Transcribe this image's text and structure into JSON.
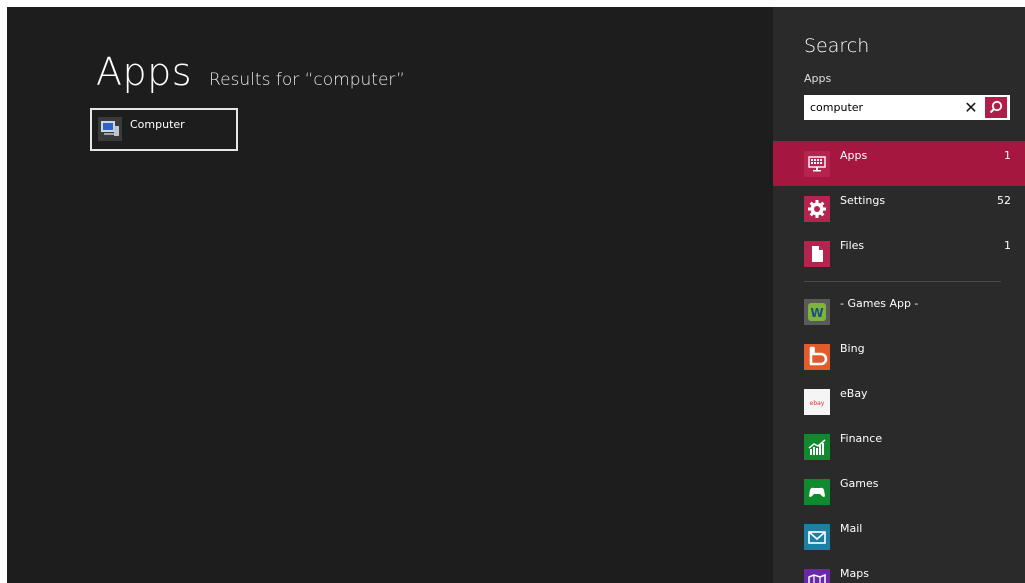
{
  "results": {
    "title": "Apps",
    "subtitle": "Results for “computer”",
    "items": [
      {
        "label": "Computer",
        "icon": "computer-icon"
      }
    ]
  },
  "charm": {
    "title": "Search",
    "scope": "Apps",
    "query": "computer",
    "scopes": [
      {
        "label": "Apps",
        "count": "1",
        "icon": "keyboard-icon",
        "selected": true
      },
      {
        "label": "Settings",
        "count": "52",
        "icon": "gear-icon"
      },
      {
        "label": "Files",
        "count": "1",
        "icon": "file-icon"
      }
    ],
    "apps": [
      {
        "label": "- Games App -",
        "icon": "games-app-icon"
      },
      {
        "label": "Bing",
        "icon": "bing-icon"
      },
      {
        "label": "eBay",
        "icon": "ebay-icon",
        "icon_text": "ebay"
      },
      {
        "label": "Finance",
        "icon": "finance-icon"
      },
      {
        "label": "Games",
        "icon": "gamepad-icon"
      },
      {
        "label": "Mail",
        "icon": "mail-icon"
      },
      {
        "label": "Maps",
        "icon": "maps-icon"
      }
    ]
  },
  "colors": {
    "background": "#1d1d1d",
    "charm_background": "#2a2a2a",
    "accent": "#a5173f",
    "scope_icon": "#b4244e",
    "bing": "#e25b2b",
    "finance": "#0f8a2f",
    "games": "#0f8a2f",
    "mail": "#1e7fa5",
    "maps": "#6a2aa8"
  }
}
